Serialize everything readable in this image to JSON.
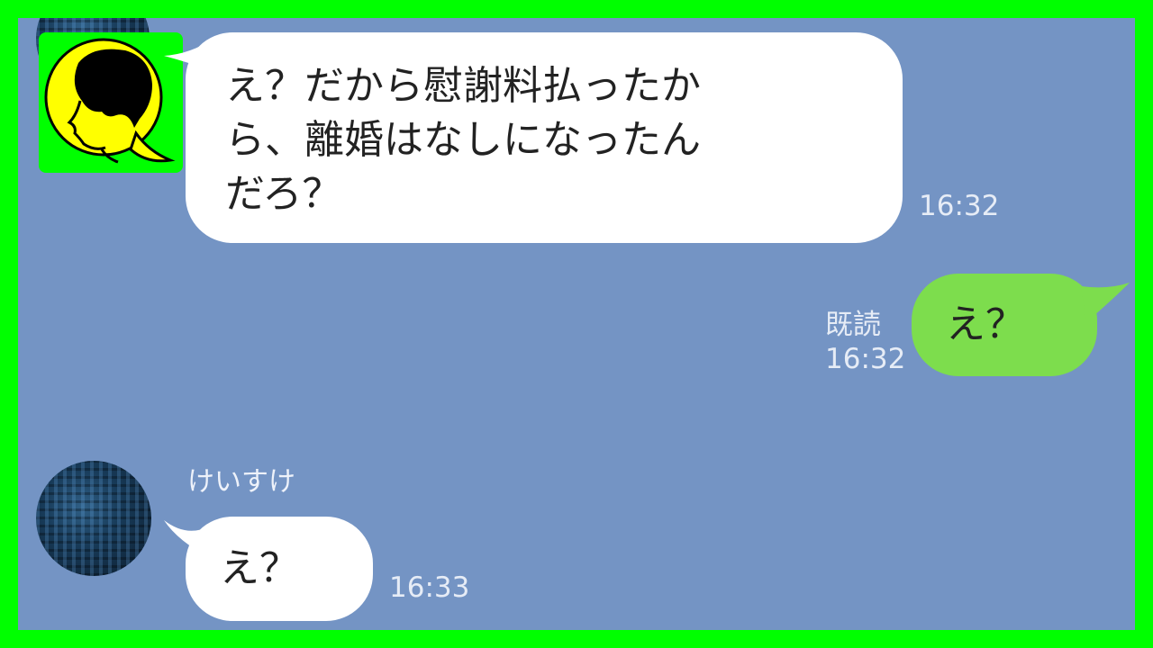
{
  "messages": [
    {
      "side": "left",
      "text_lines": [
        "え？だから慰謝料払ったか",
        "ら、離婚はなしになったん",
        "だろ？"
      ],
      "time": "16:32"
    },
    {
      "side": "right",
      "text": "え？",
      "read_label": "既読",
      "time": "16:32"
    },
    {
      "side": "left",
      "sender": "けいすけ",
      "text": "え？",
      "time": "16:33"
    }
  ],
  "colors": {
    "border": "#00ff00",
    "chat_background": "#7494c4",
    "bubble_left": "#ffffff",
    "bubble_right": "#7ddd4d"
  },
  "icons": [
    "person-silhouette-icon",
    "contact-avatar"
  ]
}
